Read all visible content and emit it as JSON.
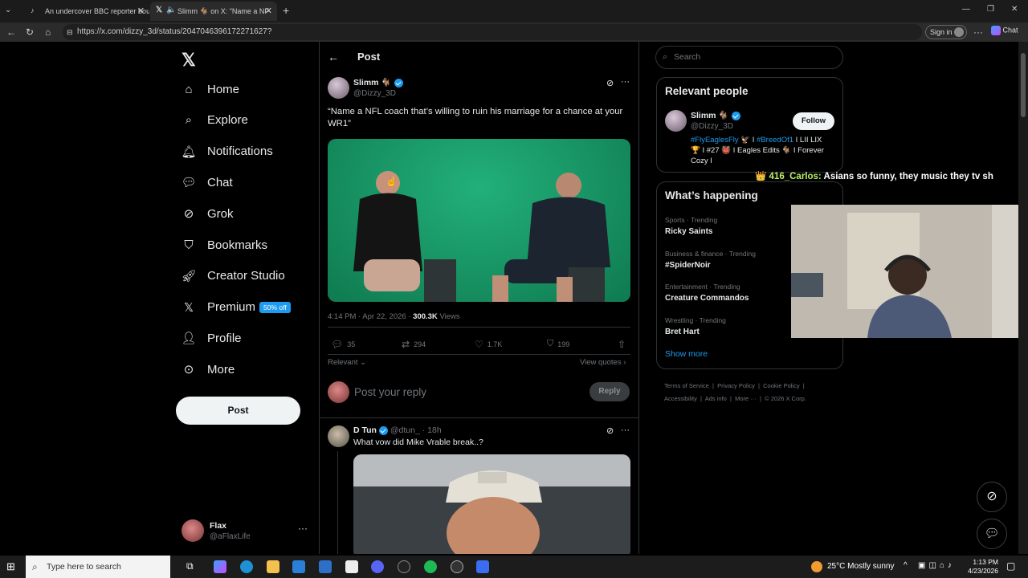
{
  "browser": {
    "tabs": [
      {
        "title": "An undercover BBC reporter boug"
      },
      {
        "title": "Slimm 🐐 on X: \"Name a NF"
      }
    ],
    "url": "https://x.com/dizzy_3d/status/2047046396172271627?",
    "sign_in": "Sign in",
    "chat": "Chat"
  },
  "sidebar": {
    "items": [
      {
        "label": "Home",
        "icon": "home-icon"
      },
      {
        "label": "Explore",
        "icon": "search-icon"
      },
      {
        "label": "Notifications",
        "icon": "bell-icon"
      },
      {
        "label": "Chat",
        "icon": "chat-icon"
      },
      {
        "label": "Grok",
        "icon": "grok-icon"
      },
      {
        "label": "Bookmarks",
        "icon": "bookmark-icon"
      },
      {
        "label": "Creator Studio",
        "icon": "rocket-icon"
      },
      {
        "label": "Premium",
        "icon": "x-icon"
      },
      {
        "label": "Profile",
        "icon": "person-icon"
      },
      {
        "label": "More",
        "icon": "more-circle-icon"
      }
    ],
    "premium_badge": "50% off",
    "post_button": "Post",
    "account": {
      "name": "Flax",
      "handle": "@aFlaxLife"
    }
  },
  "main": {
    "header": "Post",
    "tweet": {
      "name": "Slimm 🐐",
      "handle": "@Dizzy_3D",
      "text": "“Name a NFL coach that’s willing to ruin his marriage for a chance at your WR1”",
      "time": "4:14 PM · Apr 22, 2026 ·",
      "views_count": "300.3K",
      "views_label": "Views",
      "replies": "35",
      "reposts": "294",
      "likes": "1.7K",
      "bookmarks": "199"
    },
    "relevant": "Relevant",
    "view_quotes": "View quotes",
    "reply_placeholder": "Post your reply",
    "reply_button": "Reply",
    "reply_tweet": {
      "name": "D Tun",
      "handle": "@dtun_",
      "time": "18h",
      "text": "What vow did Mike Vrable break..?"
    }
  },
  "right": {
    "search_placeholder": "Search",
    "relevant_title": "Relevant people",
    "person": {
      "name": "Slimm 🐐",
      "handle": "@Dizzy_3D",
      "follow": "Follow",
      "bio_tags": [
        "#FlyEaglesFly",
        "#BreedOf1"
      ],
      "bio_line1_sep": " 🦅 I ",
      "bio_line1_end": " I LII LIX",
      "bio_line2": "🏆 I #27 👹 I Eagles Edits 🐐 I Forever",
      "bio_line3": "Cozy I"
    },
    "happening_title": "What’s happening",
    "trends": [
      {
        "category": "Sports · Trending",
        "name": "Ricky Saints"
      },
      {
        "category": "Business & finance · Trending",
        "name": "#SpiderNoir"
      },
      {
        "category": "Entertainment · Trending",
        "name": "Creature Commandos"
      },
      {
        "category": "Wrestling · Trending",
        "name": "Bret Hart"
      }
    ],
    "show_more": "Show more",
    "footer": [
      "Terms of Service",
      "Privacy Policy",
      "Cookie Policy",
      "Accessibility",
      "Ads info",
      "More ···",
      "© 2026 X Corp."
    ]
  },
  "overlay": {
    "chat_user": "416_Carlos:",
    "chat_msg": "Asians so funny, they music they tv sh"
  },
  "taskbar": {
    "search": "Type here to search",
    "weather": "25°C  Mostly sunny",
    "time": "1:13 PM",
    "date": "4/23/2026"
  },
  "colors": {
    "accent": "#1d9bf0",
    "background": "#000000",
    "chroma_green": "#1a9a6a"
  }
}
